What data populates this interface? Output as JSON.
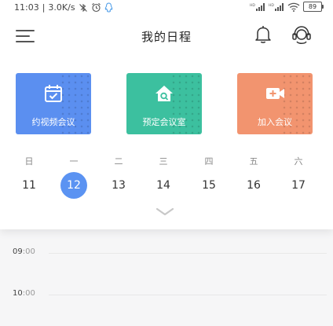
{
  "status_bar": {
    "time": "11:03",
    "network_speed": "3.0K/s",
    "battery": "89",
    "icons": [
      "bluetooth-off-icon",
      "alarm-icon",
      "qq-icon",
      "signal-icon",
      "wifi-icon",
      "battery-icon"
    ]
  },
  "header": {
    "title": "我的日程",
    "icons": [
      "menu-icon",
      "bell-icon",
      "customer-service-icon"
    ]
  },
  "actions": [
    {
      "label": "约视频会议",
      "color": "#5b8ff0",
      "icon": "calendar-check-icon"
    },
    {
      "label": "预定会议室",
      "color": "#3cc09f",
      "icon": "house-search-icon"
    },
    {
      "label": "加入会议",
      "color": "#f2946f",
      "icon": "video-add-icon"
    }
  ],
  "week": {
    "weekdays": [
      "日",
      "一",
      "二",
      "三",
      "四",
      "五",
      "六"
    ],
    "dates": [
      "11",
      "12",
      "13",
      "14",
      "15",
      "16",
      "17"
    ],
    "selected_index": 1,
    "accent_color": "#5b93f2"
  },
  "timeline": {
    "slots": [
      {
        "hour": "09",
        "minutes": ":00"
      },
      {
        "hour": "10",
        "minutes": ":00"
      }
    ]
  }
}
